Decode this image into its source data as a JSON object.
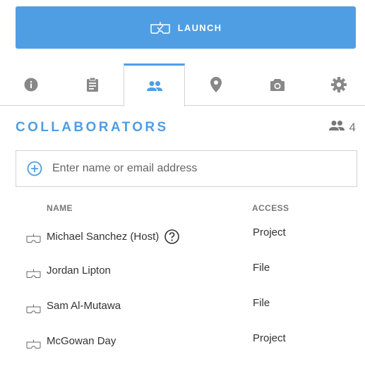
{
  "launch": {
    "label": "LAUNCH",
    "icon": "headset-icon"
  },
  "tabs": [
    {
      "name": "info",
      "icon": "info-icon",
      "active": false
    },
    {
      "name": "notes",
      "icon": "clipboard-icon",
      "active": false
    },
    {
      "name": "collaborators",
      "icon": "people-icon",
      "active": true
    },
    {
      "name": "location",
      "icon": "location-pin-icon",
      "active": false
    },
    {
      "name": "camera",
      "icon": "camera-icon",
      "active": false
    },
    {
      "name": "settings",
      "icon": "gear-icon",
      "active": false
    }
  ],
  "section": {
    "title": "COLLABORATORS",
    "count": "4"
  },
  "search": {
    "placeholder": "Enter name or email address"
  },
  "table": {
    "headers": {
      "name": "NAME",
      "access": "ACCESS"
    },
    "rows": [
      {
        "name": "Michael Sanchez (Host)",
        "access": "Project",
        "help": true
      },
      {
        "name": "Jordan Lipton",
        "access": "File",
        "help": false
      },
      {
        "name": "Sam Al-Mutawa",
        "access": "File",
        "help": false
      },
      {
        "name": "McGowan Day",
        "access": "Project",
        "help": false
      }
    ]
  },
  "colors": {
    "accent": "#4f9ee3",
    "icon_gray": "#888888",
    "border": "#d3d3d3"
  }
}
